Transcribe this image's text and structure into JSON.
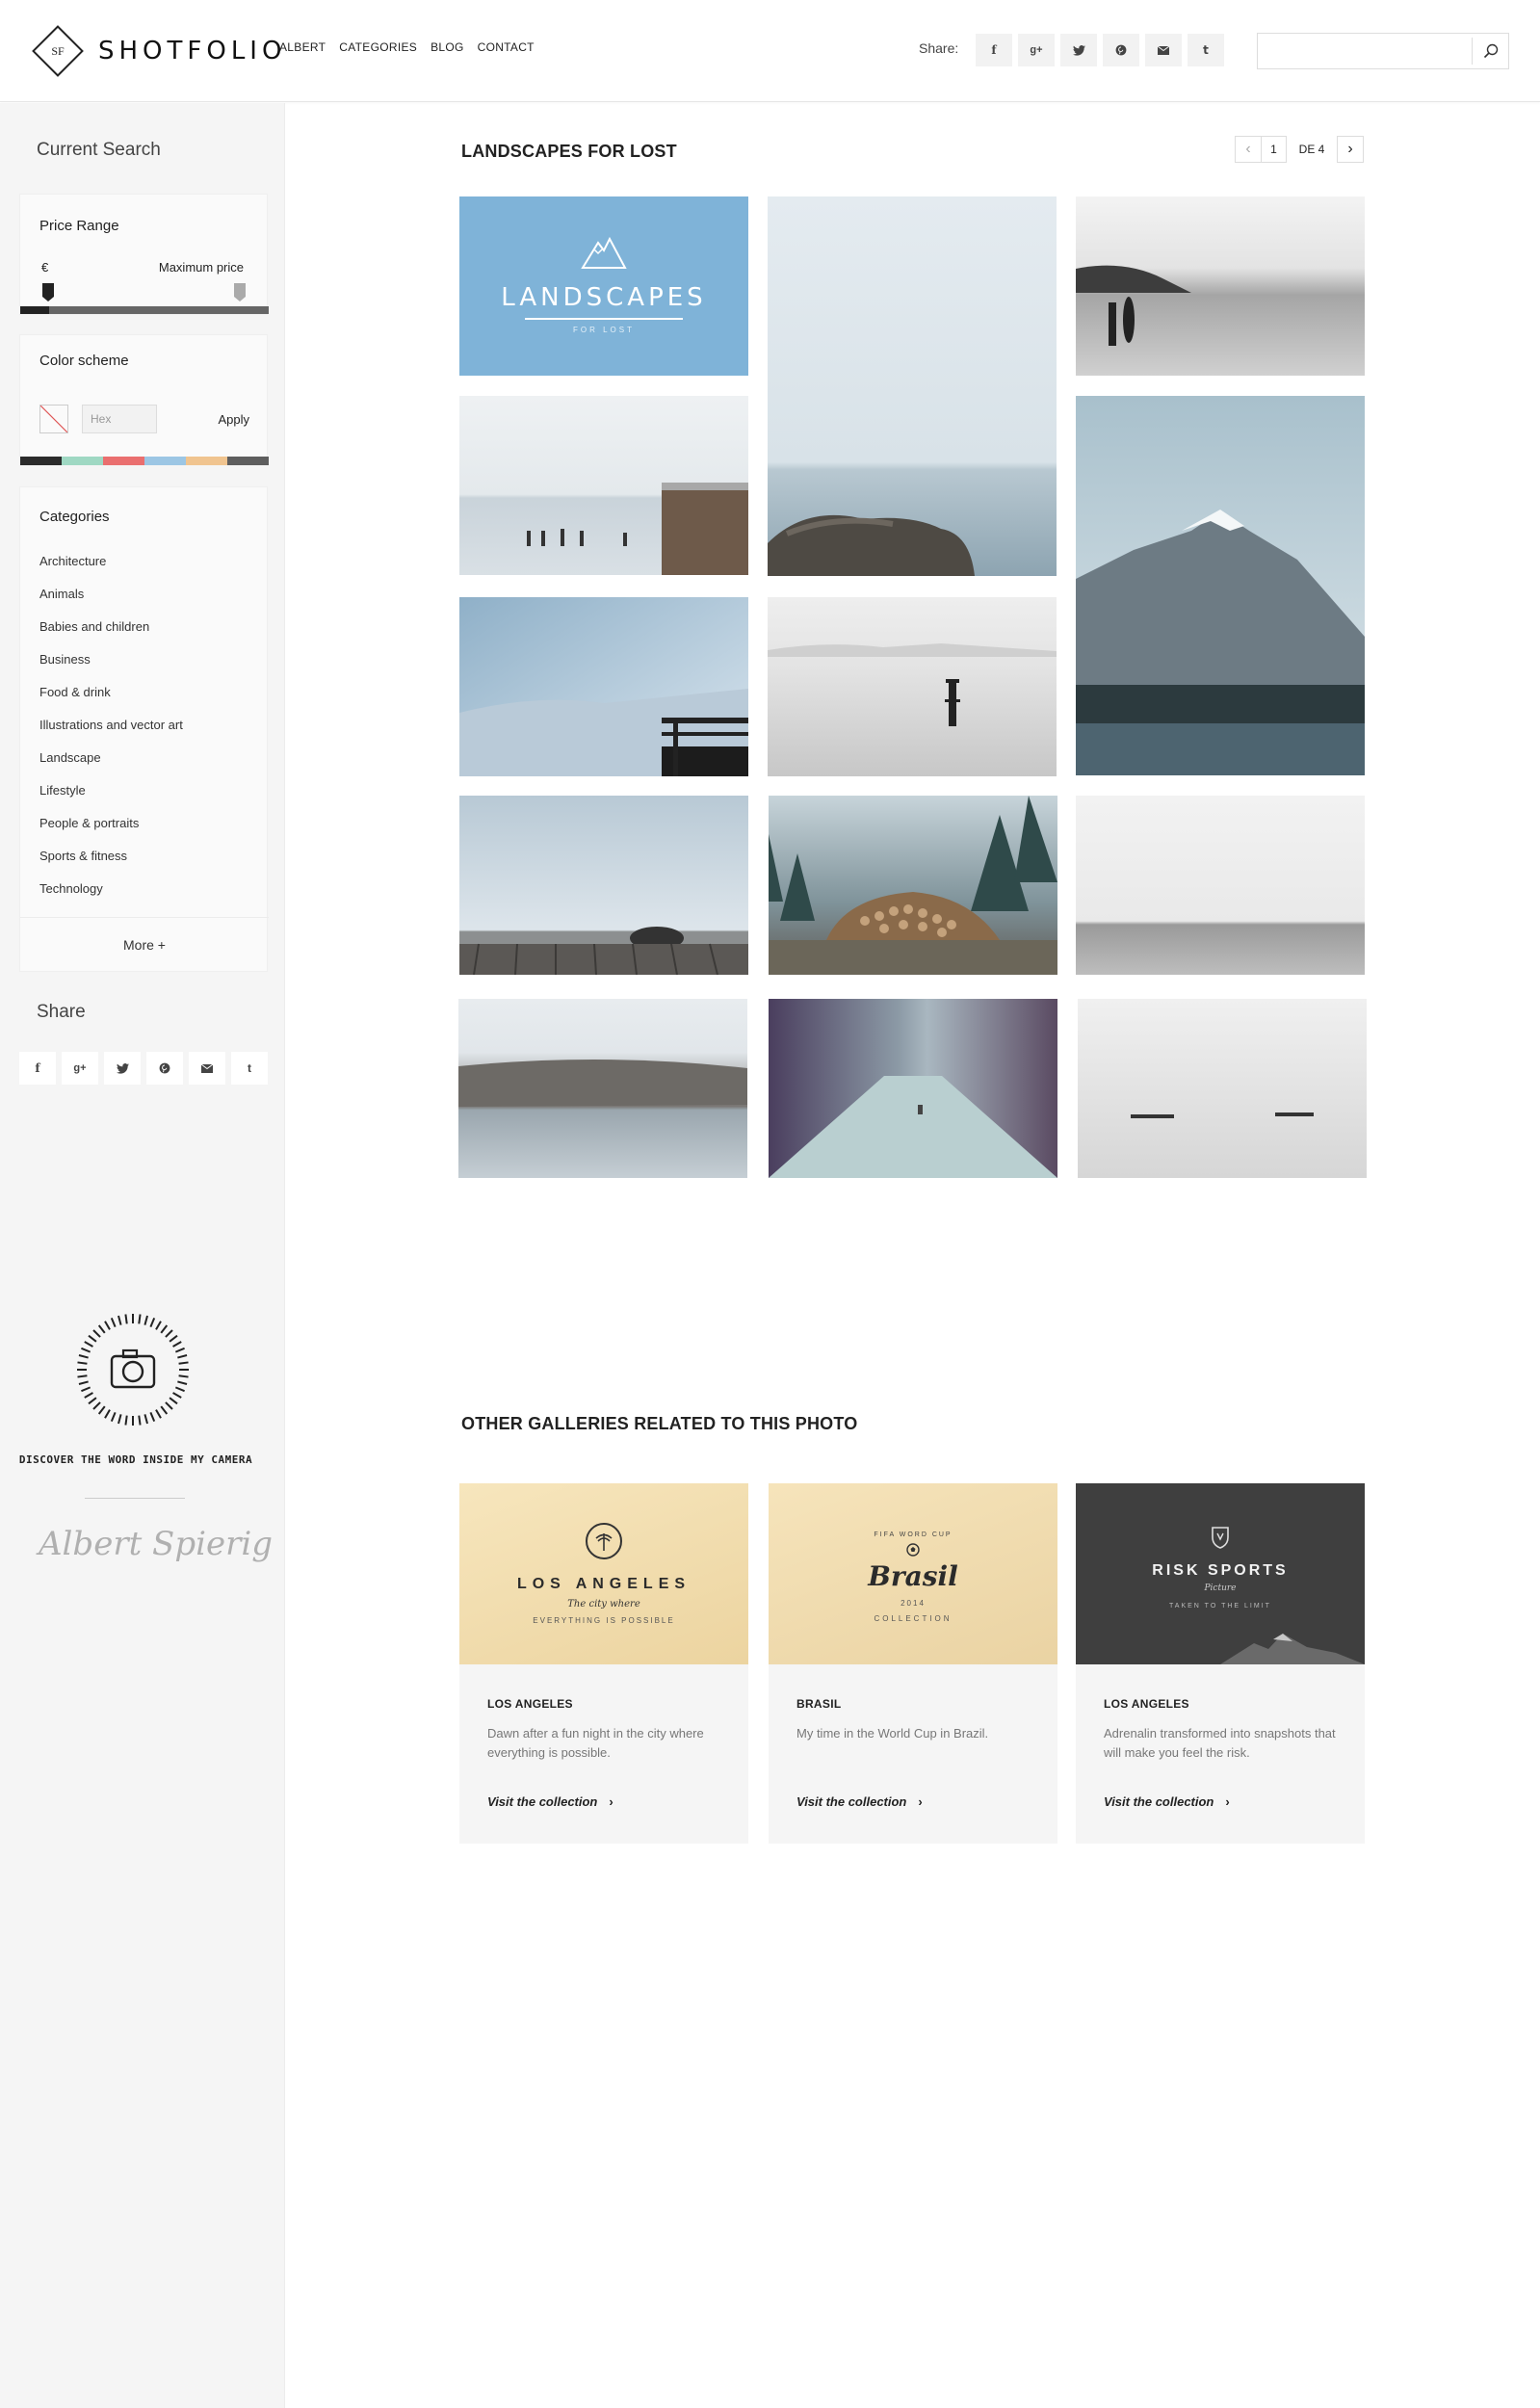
{
  "header": {
    "logo_mark": "SF",
    "logo_text": "SHOTFOLIO",
    "nav": [
      "ALBERT",
      "CATEGORIES",
      "BLOG",
      "CONTACT"
    ],
    "share_label": "Share:",
    "share_icons": [
      "f",
      "g+",
      "t",
      "p",
      "m",
      "t"
    ],
    "search_placeholder": ""
  },
  "sidebar": {
    "current_search": "Current Search",
    "price": {
      "title": "Price Range",
      "currency": "€",
      "max_label": "Maximum price"
    },
    "color": {
      "title": "Color scheme",
      "hex_placeholder": "Hex",
      "apply_label": "Apply",
      "swatches": [
        "#2b2b2b",
        "#9fd8c3",
        "#ea6f6f",
        "#9cc6e4",
        "#f0c48f",
        "#5e5e5e"
      ]
    },
    "categories": {
      "title": "Categories",
      "items": [
        "Architecture",
        "Animals",
        "Babies and children",
        "Business",
        "Food & drink",
        "Illustrations and vector art",
        "Landscape",
        "Lifestyle",
        "People & portraits",
        "Sports & fitness",
        "Technology"
      ],
      "more_label": "More +"
    },
    "share": {
      "title": "Share",
      "icons": [
        "f",
        "g+",
        "t",
        "p",
        "m",
        "t"
      ]
    },
    "promo": {
      "tagline": "DISCOVER THE WORD INSIDE MY CAMERA",
      "signature": "Albert Spierig"
    }
  },
  "gallery": {
    "title": "LANDSCAPES FOR LOST",
    "pager": {
      "prev": "‹",
      "page": "1",
      "of": "DE 4",
      "next": "›"
    },
    "cover": {
      "title": "LANDSCAPES",
      "subtitle": "FOR LOST"
    }
  },
  "related": {
    "title": "OTHER GALLERIES RELATED TO THIS PHOTO",
    "cards": [
      {
        "badge_main": "LOS ANGELES",
        "badge_script": "The city where",
        "badge_sub": "EVERYTHING IS POSSIBLE",
        "title": "LOS ANGELES",
        "desc": "Dawn after a fun night in the city where everything is possible.",
        "link": "Visit the collection"
      },
      {
        "badge_top": "FIFA WORD CUP",
        "badge_main": "Brasil",
        "badge_year": "2014",
        "badge_sub": "COLLECTION",
        "title": "BRASIL",
        "desc": "My time in the World Cup in Brazil.",
        "link": "Visit the collection"
      },
      {
        "badge_main": "RISK SPORTS",
        "badge_script": "Picture",
        "badge_sub": "TAKEN TO THE LIMIT",
        "title": "LOS ANGELES",
        "desc": "Adrenalin transformed into snapshots that will make you feel the risk.",
        "link": "Visit the collection"
      }
    ]
  }
}
